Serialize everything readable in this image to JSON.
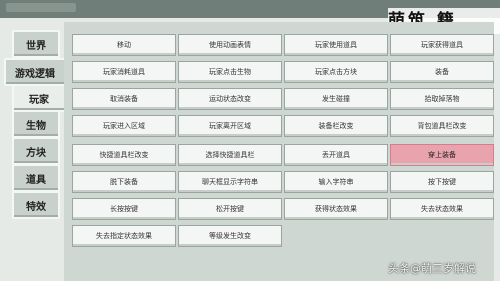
{
  "sidebar": {
    "tabs": [
      {
        "label": "世界"
      },
      {
        "label": "游戏逻辑"
      },
      {
        "label": "玩家"
      },
      {
        "label": "生物"
      },
      {
        "label": "方块"
      },
      {
        "label": "道具"
      },
      {
        "label": "特效"
      }
    ]
  },
  "blocks": [
    "移动",
    "使用动画表情",
    "玩家使用道具",
    "玩家获得道具",
    "玩家消耗道具",
    "玩家点击生物",
    "玩家点击方块",
    "装备",
    "取消装备",
    "运动状态改变",
    "发生碰撞",
    "拾取掉落物",
    "玩家进入区域",
    "玩家离开区域",
    "装备栏改变",
    "背包道具栏改变",
    "快捷道具栏改变",
    "选择快捷道具栏",
    "丢开道具",
    "穿上装备",
    "脱下装备",
    "聊天框显示字符串",
    "输入字符串",
    "按下按键",
    "长按按键",
    "松开按键",
    "获得状态效果",
    "失去状态效果",
    "失去指定状态效果",
    "等级发生改变"
  ],
  "watermark": {
    "logo": "萌筑 籍"
  },
  "caption": "头条@萌三岁解说"
}
